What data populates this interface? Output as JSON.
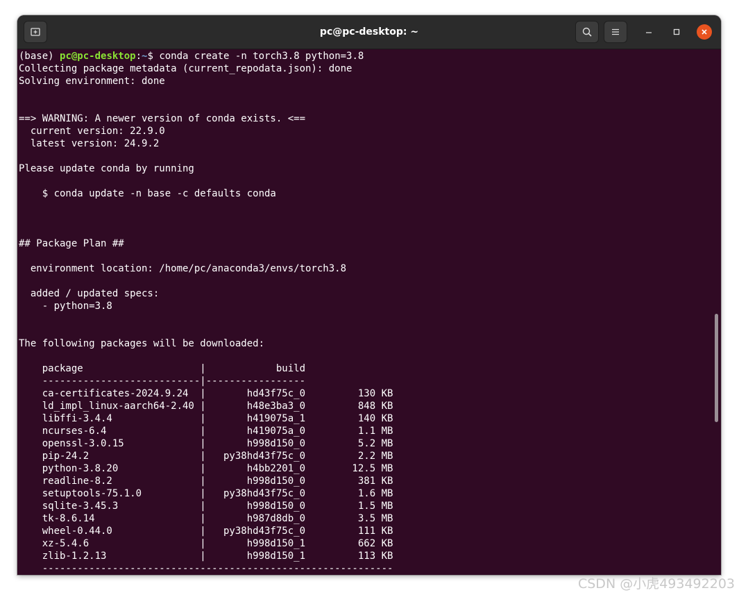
{
  "window": {
    "title": "pc@pc-desktop: ~",
    "background": "#300a24",
    "accent_close": "#e95420"
  },
  "icons": {
    "new_tab": "new-tab-icon",
    "search": "search-icon",
    "menu": "hamburger-menu-icon",
    "minimize": "minimize-icon",
    "maximize": "maximize-icon",
    "close": "close-icon"
  },
  "terminal": {
    "prompt": {
      "env": "(base) ",
      "user_host": "pc@pc-desktop",
      "sep": ":",
      "path": "~",
      "symbol": "$ ",
      "command": "conda create -n torch3.8 python=3.8"
    },
    "output_lines": [
      "Collecting package metadata (current_repodata.json): done",
      "Solving environment: done",
      "",
      "",
      "==> WARNING: A newer version of conda exists. <==",
      "  current version: 22.9.0",
      "  latest version: 24.9.2",
      "",
      "Please update conda by running",
      "",
      "    $ conda update -n base -c defaults conda",
      "",
      "",
      "",
      "## Package Plan ##",
      "",
      "  environment location: /home/pc/anaconda3/envs/torch3.8",
      "",
      "  added / updated specs:",
      "    - python=3.8",
      "",
      "",
      "The following packages will be downloaded:",
      "",
      "    package                    |            build",
      "    ---------------------------|-----------------",
      "    ca-certificates-2024.9.24  |       hd43f75c_0         130 KB",
      "    ld_impl_linux-aarch64-2.40 |       h48e3ba3_0         848 KB",
      "    libffi-3.4.4               |       h419075a_1         140 KB",
      "    ncurses-6.4                |       h419075a_0         1.1 MB",
      "    openssl-3.0.15             |       h998d150_0         5.2 MB",
      "    pip-24.2                   |   py38hd43f75c_0         2.2 MB",
      "    python-3.8.20              |       h4bb2201_0        12.5 MB",
      "    readline-8.2               |       h998d150_0         381 KB",
      "    setuptools-75.1.0          |   py38hd43f75c_0         1.6 MB",
      "    sqlite-3.45.3              |       h998d150_0         1.5 MB",
      "    tk-8.6.14                  |       h987d8db_0         3.5 MB",
      "    wheel-0.44.0               |   py38hd43f75c_0         111 KB",
      "    xz-5.4.6                   |       h998d150_1         662 KB",
      "    zlib-1.2.13                |       h998d150_1         113 KB",
      "    ------------------------------------------------------------"
    ]
  },
  "watermark": "CSDN @小虎493492203"
}
